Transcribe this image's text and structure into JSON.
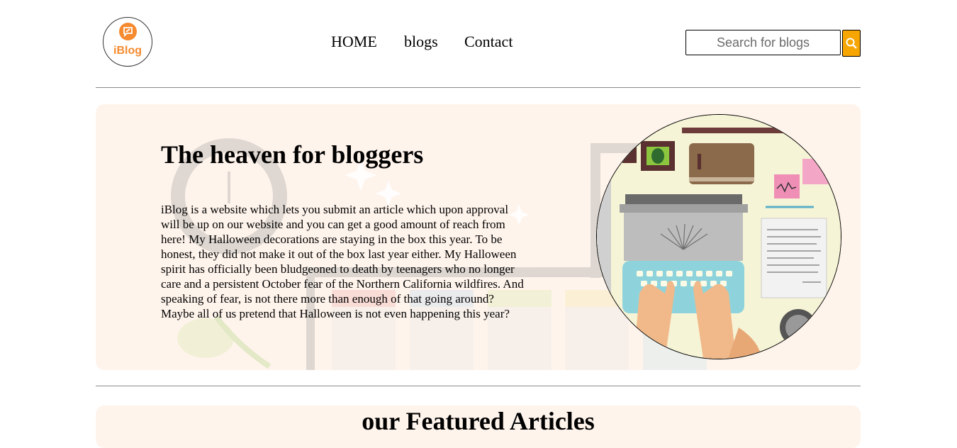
{
  "header": {
    "logo_text": "iBlog",
    "nav": [
      {
        "label": "HOME"
      },
      {
        "label": "blogs"
      },
      {
        "label": "Contact"
      }
    ],
    "search": {
      "placeholder": "Search for blogs"
    }
  },
  "hero": {
    "title": "The heaven for bloggers",
    "body": "iBlog is a website which lets you submit an article which upon approval will be up on our website and you can get a good amount of reach from here! My Halloween decorations are staying in the box this year. To be honest, they did not make it out of the box last year either. My Halloween spirit has officially been bludgeoned to death by teenagers who no longer care and a persistent October fear of the Northern California wildfires. And speaking of fear, is not there more than enough of that going around? Maybe all of us pretend that Halloween is not even happening this year?"
  },
  "featured": {
    "title": "our Featured Articles"
  },
  "colors": {
    "accent": "#f58a2f",
    "search_button": "#f7a500",
    "panel": "#fff4ec"
  }
}
